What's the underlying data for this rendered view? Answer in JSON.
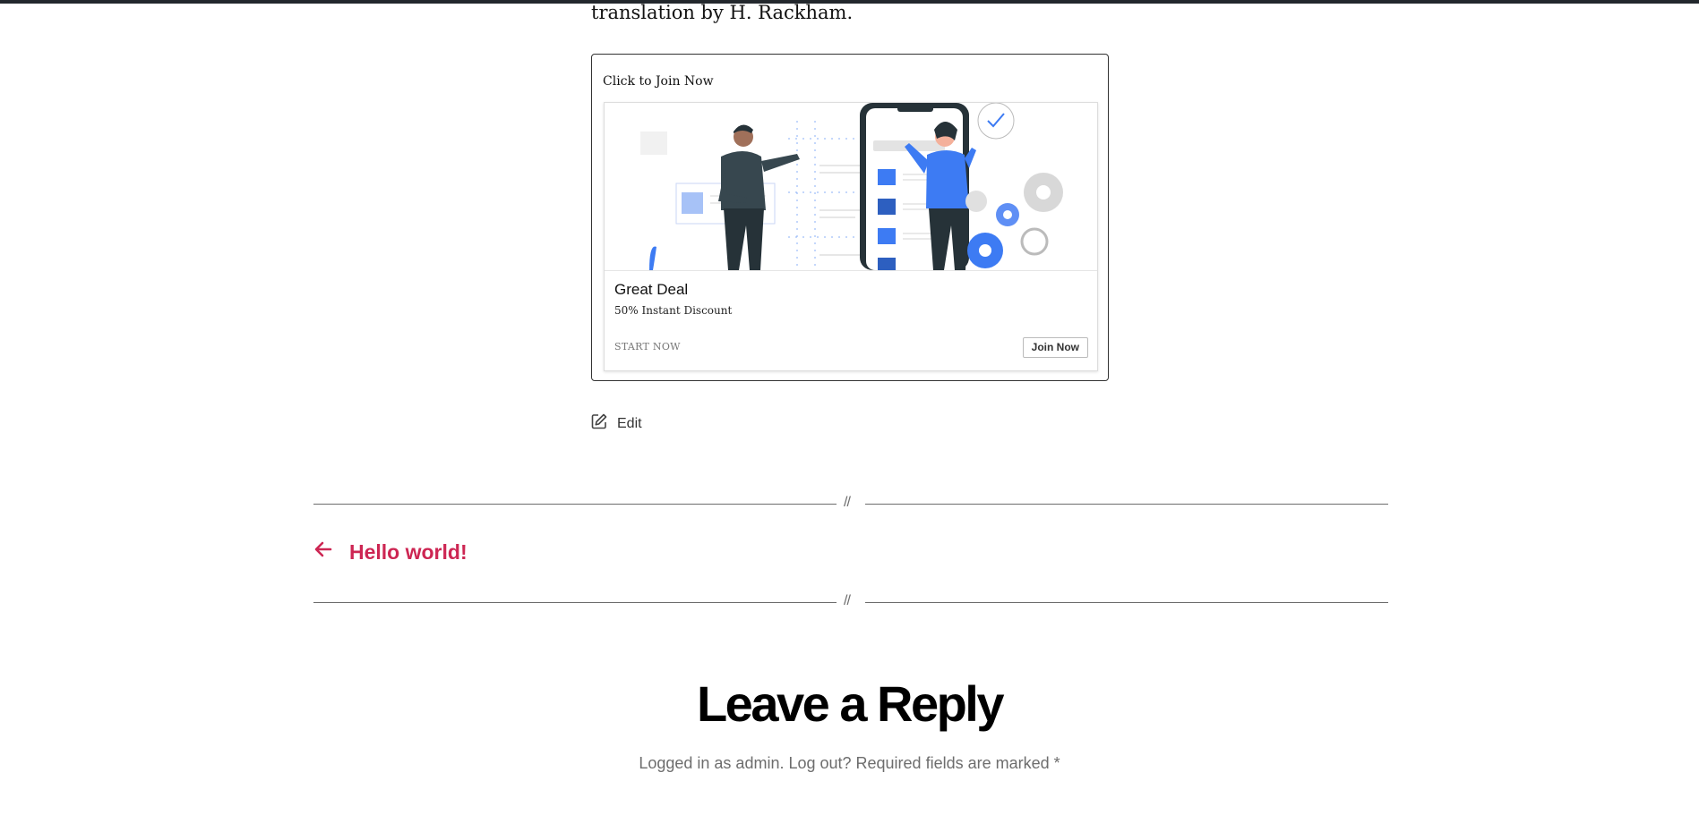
{
  "article": {
    "intro_text": "translation by H. Rackham."
  },
  "ad": {
    "header": "Click to Join Now",
    "title": "Great Deal",
    "subtitle": "50% Instant Discount",
    "cta_text": "START NOW",
    "button_label": "Join Now",
    "accent_color": "#3d7bf3"
  },
  "edit": {
    "label": "Edit",
    "icon": "edit-icon"
  },
  "divider": {
    "mark": "//"
  },
  "post_nav": {
    "prev_label": "Hello world!",
    "icon": "arrow-left-icon",
    "color": "#cd2653"
  },
  "comments": {
    "title": "Leave a Reply",
    "logged_in_text": "Logged in as admin. Log out? Required fields are marked *"
  }
}
